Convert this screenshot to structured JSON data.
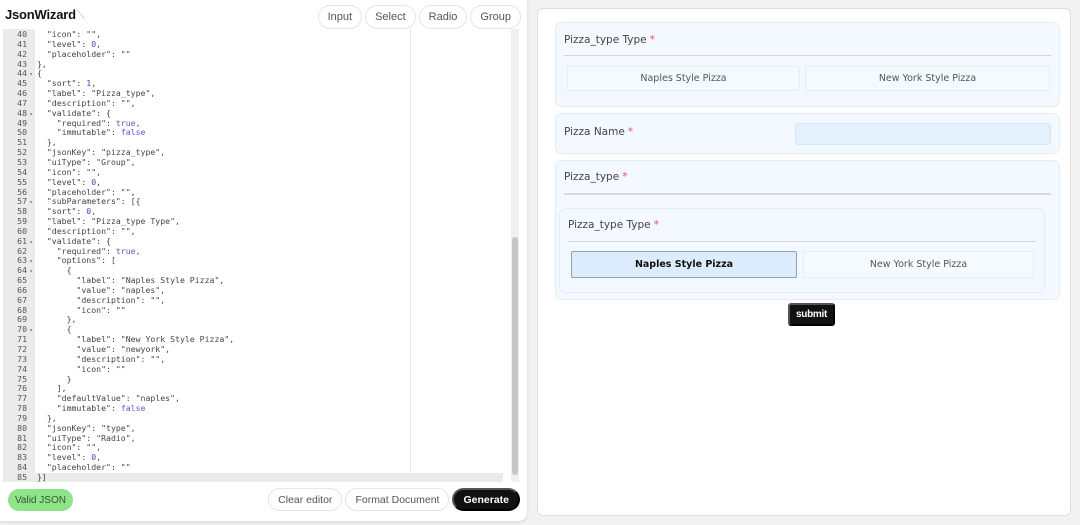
{
  "app": {
    "title": "JsonWizard",
    "logo_icon": "magic-wand-icon"
  },
  "type_buttons": [
    "Input",
    "Select",
    "Radio",
    "Group"
  ],
  "editor": {
    "active_line": 85,
    "lines": [
      {
        "n": 40,
        "fold": false,
        "text": "  \"icon\": \"\","
      },
      {
        "n": 41,
        "fold": false,
        "text": "  \"level\": 0,"
      },
      {
        "n": 42,
        "fold": false,
        "text": "  \"placeholder\": \"\""
      },
      {
        "n": 43,
        "fold": false,
        "text": "},"
      },
      {
        "n": 44,
        "fold": true,
        "text": "{"
      },
      {
        "n": 45,
        "fold": false,
        "text": "  \"sort\": 1,"
      },
      {
        "n": 46,
        "fold": false,
        "text": "  \"label\": \"Pizza_type\","
      },
      {
        "n": 47,
        "fold": false,
        "text": "  \"description\": \"\","
      },
      {
        "n": 48,
        "fold": true,
        "text": "  \"validate\": {"
      },
      {
        "n": 49,
        "fold": false,
        "text": "    \"required\": true,"
      },
      {
        "n": 50,
        "fold": false,
        "text": "    \"immutable\": false"
      },
      {
        "n": 51,
        "fold": false,
        "text": "  },"
      },
      {
        "n": 52,
        "fold": false,
        "text": "  \"jsonKey\": \"pizza_type\","
      },
      {
        "n": 53,
        "fold": false,
        "text": "  \"uiType\": \"Group\","
      },
      {
        "n": 54,
        "fold": false,
        "text": "  \"icon\": \"\","
      },
      {
        "n": 55,
        "fold": false,
        "text": "  \"level\": 0,"
      },
      {
        "n": 56,
        "fold": false,
        "text": "  \"placeholder\": \"\","
      },
      {
        "n": 57,
        "fold": true,
        "text": "  \"subParameters\": [{"
      },
      {
        "n": 58,
        "fold": false,
        "text": "  \"sort\": 0,"
      },
      {
        "n": 59,
        "fold": false,
        "text": "  \"label\": \"Pizza_type Type\","
      },
      {
        "n": 60,
        "fold": false,
        "text": "  \"description\": \"\","
      },
      {
        "n": 61,
        "fold": true,
        "text": "  \"validate\": {"
      },
      {
        "n": 62,
        "fold": false,
        "text": "    \"required\": true,"
      },
      {
        "n": 63,
        "fold": true,
        "text": "    \"options\": ["
      },
      {
        "n": 64,
        "fold": true,
        "text": "      {"
      },
      {
        "n": 65,
        "fold": false,
        "text": "        \"label\": \"Naples Style Pizza\","
      },
      {
        "n": 66,
        "fold": false,
        "text": "        \"value\": \"naples\","
      },
      {
        "n": 67,
        "fold": false,
        "text": "        \"description\": \"\","
      },
      {
        "n": 68,
        "fold": false,
        "text": "        \"icon\": \"\""
      },
      {
        "n": 69,
        "fold": false,
        "text": "      },"
      },
      {
        "n": 70,
        "fold": true,
        "text": "      {"
      },
      {
        "n": 71,
        "fold": false,
        "text": "        \"label\": \"New York Style Pizza\","
      },
      {
        "n": 72,
        "fold": false,
        "text": "        \"value\": \"newyork\","
      },
      {
        "n": 73,
        "fold": false,
        "text": "        \"description\": \"\","
      },
      {
        "n": 74,
        "fold": false,
        "text": "        \"icon\": \"\""
      },
      {
        "n": 75,
        "fold": false,
        "text": "      }"
      },
      {
        "n": 76,
        "fold": false,
        "text": "    ],"
      },
      {
        "n": 77,
        "fold": false,
        "text": "    \"defaultValue\": \"naples\","
      },
      {
        "n": 78,
        "fold": false,
        "text": "    \"immutable\": false"
      },
      {
        "n": 79,
        "fold": false,
        "text": "  },"
      },
      {
        "n": 80,
        "fold": false,
        "text": "  \"jsonKey\": \"type\","
      },
      {
        "n": 81,
        "fold": false,
        "text": "  \"uiType\": \"Radio\","
      },
      {
        "n": 82,
        "fold": false,
        "text": "  \"icon\": \"\","
      },
      {
        "n": 83,
        "fold": false,
        "text": "  \"level\": 0,"
      },
      {
        "n": 84,
        "fold": false,
        "text": "  \"placeholder\": \"\""
      },
      {
        "n": 85,
        "fold": false,
        "text": "}]"
      }
    ]
  },
  "status": {
    "valid_label": "Valid JSON",
    "valid_color": "#8fe48a"
  },
  "actions": {
    "clear": "Clear editor",
    "format": "Format Document",
    "generate": "Generate"
  },
  "preview": {
    "group1": {
      "label": "Pizza_type Type",
      "required": "*",
      "options": [
        "Naples Style Pizza",
        "New York Style Pizza"
      ]
    },
    "pizza_name": {
      "label": "Pizza Name",
      "required": "*",
      "value": ""
    },
    "group2": {
      "label": "Pizza_type",
      "required": "*",
      "inner": {
        "label": "Pizza_type Type",
        "required": "*",
        "options": [
          "Naples Style Pizza",
          "New York Style Pizza"
        ],
        "selected": "Naples Style Pizza"
      }
    },
    "submit_label": "submit"
  }
}
